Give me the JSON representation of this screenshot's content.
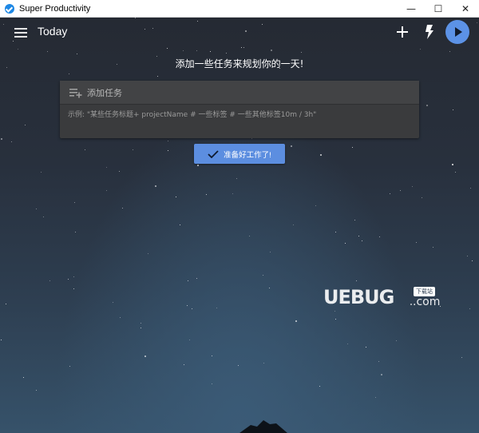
{
  "window": {
    "title": "Super Productivity",
    "controls": {
      "minimize": "—",
      "maximize": "☐",
      "close": "✕"
    }
  },
  "header": {
    "menu_icon": "menu-icon",
    "title": "Today",
    "add_icon": "plus-icon",
    "bolt_icon": "bolt-icon",
    "play_icon": "play-icon"
  },
  "main": {
    "headline": "添加一些任务来规划你的一天!",
    "add_task": {
      "placeholder": "添加任务",
      "hint": "示例: \"某些任务标题+ projectName # 一些标签 # 一些其他标签10m / 3h\""
    },
    "ready_button": {
      "label": "准备好工作了!"
    }
  },
  "watermark": {
    "brand": "UEBUG",
    "suffix": ".com",
    "tag": "下载站"
  },
  "colors": {
    "accent": "#5c8ee0",
    "play": "#5c92e6",
    "card": "#3a3b3d",
    "titlebar": "#ffffff"
  }
}
